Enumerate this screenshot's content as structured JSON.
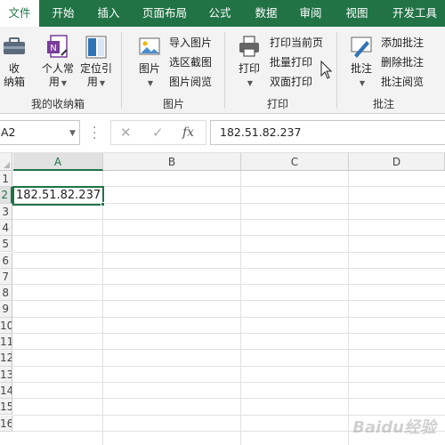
{
  "ribbon_tabs": [
    "文件",
    "开始",
    "插入",
    "页面布局",
    "公式",
    "数据",
    "审阅",
    "视图",
    "开发工具"
  ],
  "groups": {
    "favorites": {
      "label": "我的收纳箱",
      "btn_store_line1": "收",
      "btn_store_line2": "纳箱",
      "btn_personal_line1": "个人常",
      "btn_personal_line2": "用",
      "btn_locate_line1": "定位引",
      "btn_locate_line2": "用"
    },
    "picture": {
      "label": "图片",
      "btn_picture_line1": "图片",
      "import": "导入图片",
      "screenshot": "选区截图",
      "browse": "图片阅览"
    },
    "print": {
      "label": "打印",
      "btn_print_line1": "打印",
      "current_page": "打印当前页",
      "batch": "批量打印",
      "duplex": "双面打印"
    },
    "comment": {
      "label": "批注",
      "btn_comment_line1": "批注",
      "add": "添加批注",
      "delete": "删除批注",
      "review": "批注阅览"
    }
  },
  "formula_bar": {
    "name_box": "A2",
    "fx": "fx",
    "cancel": "✕",
    "confirm": "✓",
    "value": "182.51.82.237"
  },
  "sheet": {
    "columns": [
      "A",
      "B",
      "C",
      "D"
    ],
    "rows": [
      "1",
      "2",
      "3",
      "4",
      "5",
      "6",
      "7",
      "8",
      "9",
      "10",
      "11",
      "12",
      "13",
      "14",
      "15",
      "16"
    ],
    "cell_A2": "182.51.82.237"
  },
  "watermark": "Baidu经验",
  "colors": {
    "accent": "#217346",
    "ribbon_bg": "#f3f3f3"
  }
}
